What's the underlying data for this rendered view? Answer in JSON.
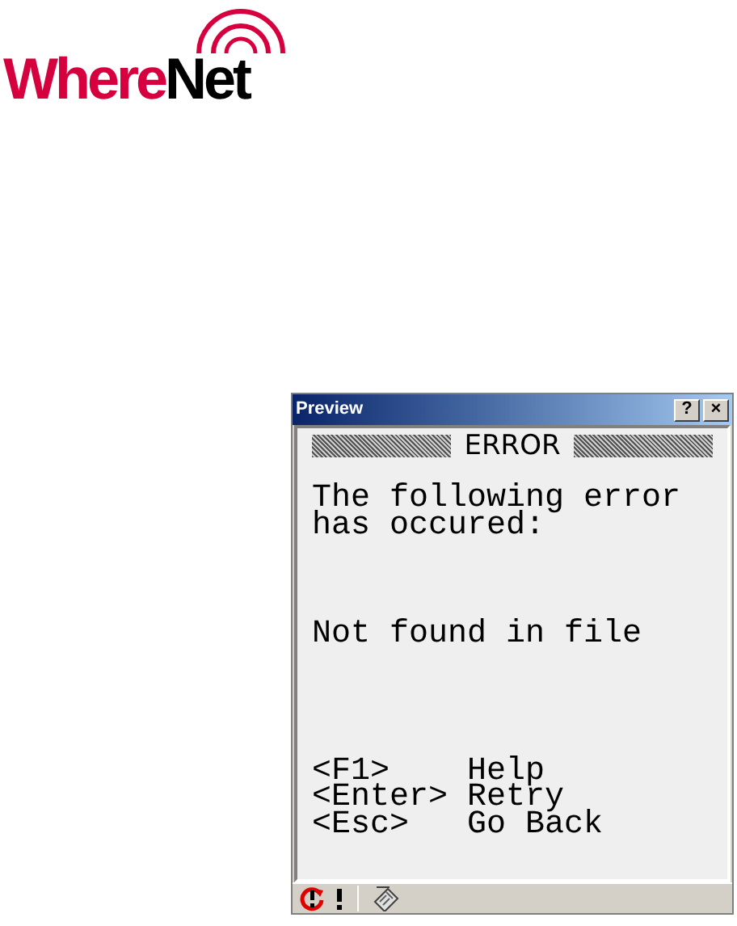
{
  "logo": {
    "part_1": "Where",
    "part_2": "Net"
  },
  "window": {
    "title": "Preview",
    "buttons": [
      "?",
      "×"
    ]
  },
  "screen": {
    "heading": "ERROR",
    "message": [
      "The following error",
      "has occured:"
    ],
    "detail": "Not found in file",
    "keys": [
      {
        "key": "<F1>",
        "action": "Help"
      },
      {
        "key": "<Enter>",
        "action": "Retry"
      },
      {
        "key": "<Esc>",
        "action": "Go Back"
      }
    ]
  }
}
